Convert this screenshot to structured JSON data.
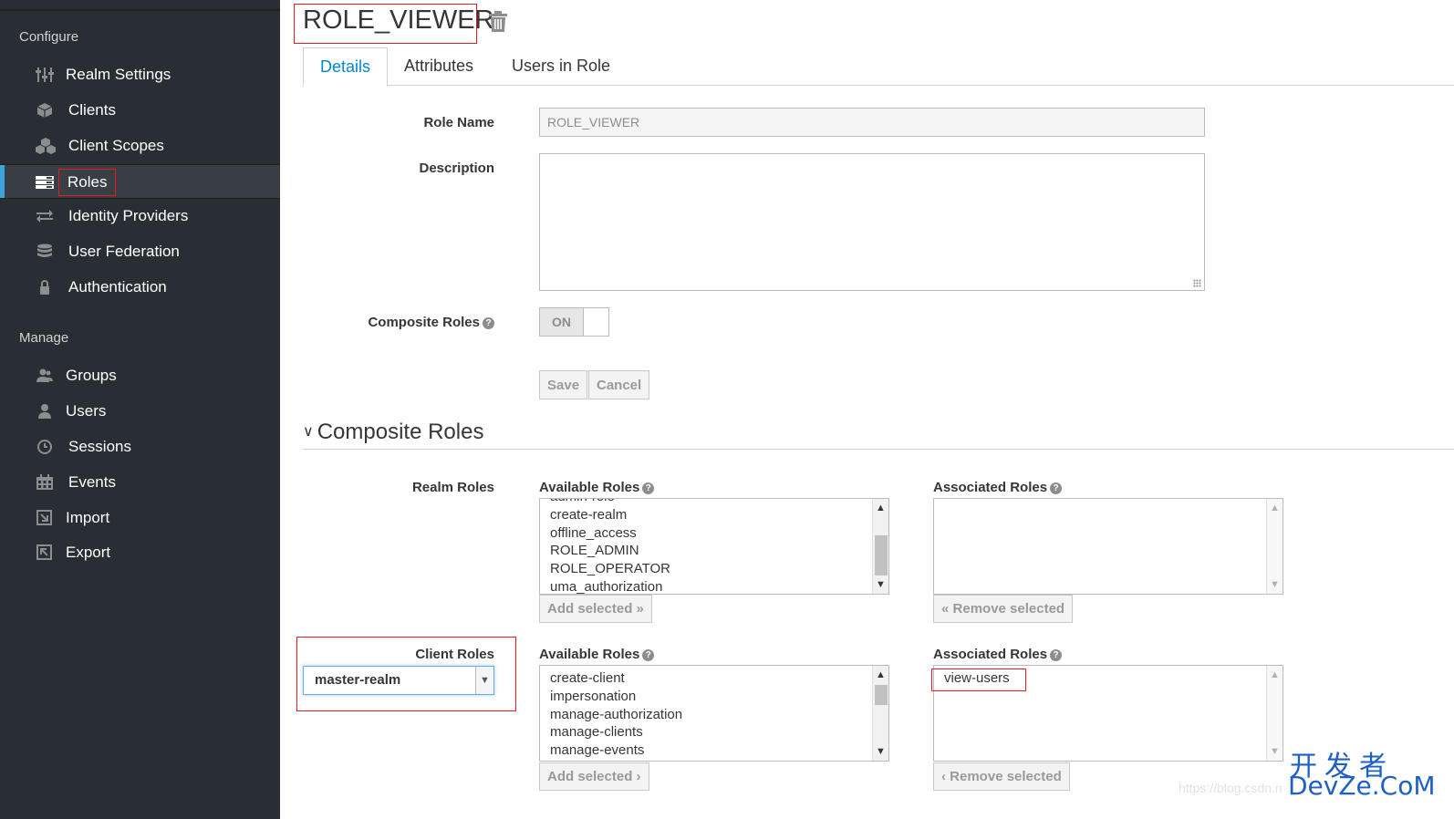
{
  "sidebar": {
    "configure_heading": "Configure",
    "manage_heading": "Manage",
    "configure_items": [
      {
        "label": "Realm Settings",
        "icon": "sliders-icon"
      },
      {
        "label": "Clients",
        "icon": "cube-icon"
      },
      {
        "label": "Client Scopes",
        "icon": "cubes-icon"
      },
      {
        "label": "Roles",
        "icon": "list-icon",
        "active": true
      },
      {
        "label": "Identity Providers",
        "icon": "exchange-icon"
      },
      {
        "label": "User Federation",
        "icon": "database-icon"
      },
      {
        "label": "Authentication",
        "icon": "lock-icon"
      }
    ],
    "manage_items": [
      {
        "label": "Groups",
        "icon": "users-icon"
      },
      {
        "label": "Users",
        "icon": "user-icon"
      },
      {
        "label": "Sessions",
        "icon": "clock-icon"
      },
      {
        "label": "Events",
        "icon": "calendar-icon"
      },
      {
        "label": "Import",
        "icon": "import-icon"
      },
      {
        "label": "Export",
        "icon": "export-icon"
      }
    ]
  },
  "header": {
    "title": "ROLE_VIEWER"
  },
  "tabs": [
    "Details",
    "Attributes",
    "Users in Role"
  ],
  "form": {
    "role_name_label": "Role Name",
    "role_name_value": "ROLE_VIEWER",
    "description_label": "Description",
    "description_value": "",
    "composite_label": "Composite Roles",
    "composite_state": "ON",
    "save_label": "Save",
    "cancel_label": "Cancel"
  },
  "composite": {
    "section_title": "Composite Roles",
    "realm_roles_label": "Realm Roles",
    "client_roles_label": "Client Roles",
    "available_label": "Available Roles",
    "associated_label": "Associated Roles",
    "add_selected_label": "Add selected",
    "remove_selected_label": "Remove selected",
    "realm_available": [
      "admin-role",
      "create-realm",
      "offline_access",
      "ROLE_ADMIN",
      "ROLE_OPERATOR",
      "uma_authorization"
    ],
    "realm_associated": [],
    "client_select_value": "master-realm",
    "client_available": [
      "create-client",
      "impersonation",
      "manage-authorization",
      "manage-clients",
      "manage-events"
    ],
    "client_associated": [
      "view-users"
    ]
  },
  "watermark": {
    "url": "https://blog.csdn.n",
    "logo_cn": "开发者",
    "logo_en": "DevZe.CoM"
  },
  "colors": {
    "accent": "#0088ce",
    "sidebar_bg": "#292e34",
    "highlight": "#e31b23"
  }
}
